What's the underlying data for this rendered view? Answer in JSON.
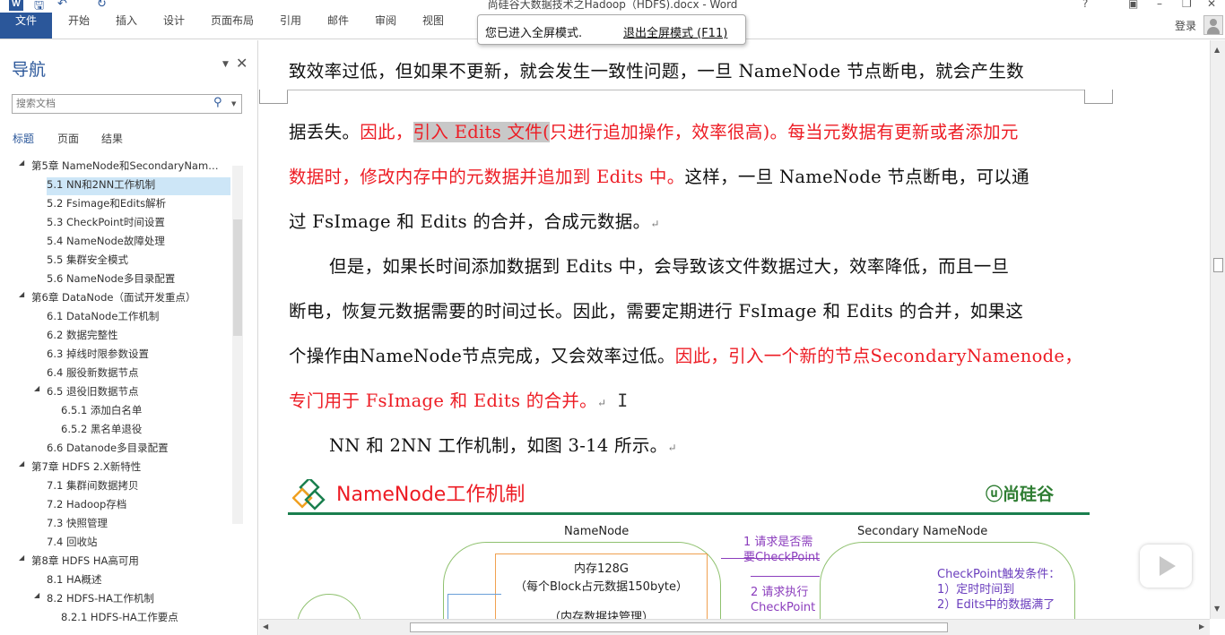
{
  "window": {
    "title": "尚硅谷大数据技术之Hadoop（HDFS).docx - Word",
    "app_icon_letter": "W"
  },
  "ribbon": {
    "tabs": [
      "文件",
      "开始",
      "插入",
      "设计",
      "页面布局",
      "引用",
      "邮件",
      "审阅",
      "视图"
    ],
    "login_label": "登录"
  },
  "toast": {
    "message": "您已进入全屏模式.",
    "exit_label": "退出全屏模式 (F11)"
  },
  "nav": {
    "title": "导航",
    "search_placeholder": "搜索文档",
    "tabs": [
      "标题",
      "页面",
      "结果"
    ],
    "items": [
      {
        "label": "第5章 NameNode和SecondaryNam…",
        "level": 1,
        "expanded": true
      },
      {
        "label": "5.1 NN和2NN工作机制",
        "level": 2,
        "selected": true
      },
      {
        "label": "5.2 Fsimage和Edits解析",
        "level": 2
      },
      {
        "label": "5.3 CheckPoint时间设置",
        "level": 2
      },
      {
        "label": "5.4 NameNode故障处理",
        "level": 2
      },
      {
        "label": "5.5 集群安全模式",
        "level": 2
      },
      {
        "label": "5.6 NameNode多目录配置",
        "level": 2
      },
      {
        "label": "第6章 DataNode（面试开发重点）",
        "level": 1,
        "expanded": true
      },
      {
        "label": "6.1 DataNode工作机制",
        "level": 2
      },
      {
        "label": "6.2 数据完整性",
        "level": 2
      },
      {
        "label": "6.3 掉线时限参数设置",
        "level": 2
      },
      {
        "label": "6.4 服役新数据节点",
        "level": 2
      },
      {
        "label": "6.5 退役旧数据节点",
        "level": 2,
        "expanded": true
      },
      {
        "label": "6.5.1 添加白名单",
        "level": 3
      },
      {
        "label": "6.5.2 黑名单退役",
        "level": 3
      },
      {
        "label": "6.6 Datanode多目录配置",
        "level": 2
      },
      {
        "label": "第7章 HDFS 2.X新特性",
        "level": 1,
        "expanded": true
      },
      {
        "label": "7.1 集群间数据拷贝",
        "level": 2
      },
      {
        "label": "7.2 Hadoop存档",
        "level": 2
      },
      {
        "label": "7.3 快照管理",
        "level": 2
      },
      {
        "label": "7.4 回收站",
        "level": 2
      },
      {
        "label": "第8章 HDFS HA高可用",
        "level": 1,
        "expanded": true
      },
      {
        "label": "8.1 HA概述",
        "level": 2
      },
      {
        "label": "8.2 HDFS-HA工作机制",
        "level": 2,
        "expanded": true
      },
      {
        "label": "8.2.1 HDFS-HA工作要点",
        "level": 3
      }
    ]
  },
  "document": {
    "line1": "致效率过低，但如果不更新，就会发生一致性问题，一旦 NameNode 节点断电，就会产生数",
    "line2_black": "据丢失。",
    "line2_red_a": "因此，",
    "line2_red_hl": "引入 Edits 文件(",
    "line2_red_b": "只进行追加操作，效率很高)。每当元数据有更新或者添加元",
    "line3_red": "数据时，修改内存中的元数据并追加到 Edits 中。",
    "line3_black": "这样，一旦 NameNode 节点断电，可以通",
    "line4": "过 FsImage 和 Edits 的合并，合成元数据。",
    "line5": "但是，如果长时间添加数据到 Edits 中，会导致该文件数据过大，效率降低，而且一旦",
    "line6": "断电，恢复元数据需要的时间过长。因此，需要定期进行 FsImage 和 Edits 的合并，如果这",
    "line7_black": "个操作由NameNode节点完成，又会效率过低。",
    "line7_red": "因此，引入一个新的节点SecondaryNamenode，",
    "line8_red": "专门用于 FsImage 和 Edits 的合并。",
    "line9": "NN 和 2NN 工作机制，如图 3-14 所示。",
    "paragraph_mark": "↵"
  },
  "figure": {
    "title": "NameNode工作机制",
    "brand": "尚硅谷",
    "namenode_label": "NameNode",
    "secondary_label": "Secondary NameNode",
    "memory_line1": "内存128G",
    "memory_line2": "（每个Block占元数据150byte）",
    "memory_line3": "（内存数据块管理）",
    "step1_a": "1 请求是否需",
    "step1_b": "要CheckPoint",
    "step2_a": "2 请求执行",
    "step2_b": "CheckPoint",
    "trigger_title": "CheckPoint触发条件：",
    "trigger_1": "1）定时时间到",
    "trigger_2": "2）Edits中的数据满了"
  },
  "colors": {
    "accent": "#2b579a",
    "red_text": "#ed1c24",
    "highlight": "#c8c8c8",
    "figure_green": "#1a7f4e",
    "figure_purple": "#8b3dbd"
  }
}
